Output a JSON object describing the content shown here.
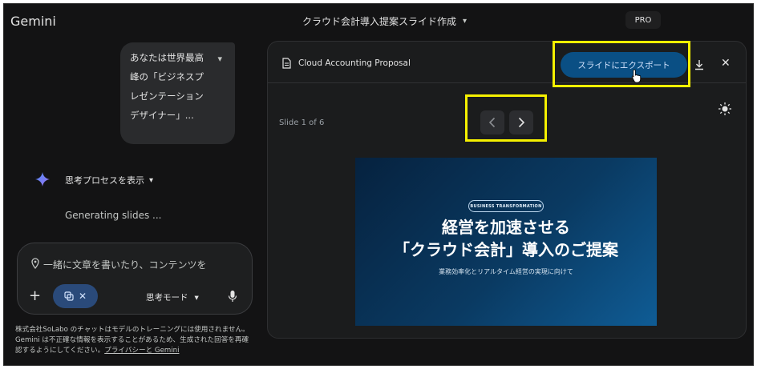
{
  "header": {
    "app_title": "Gemini",
    "chat_title": "クラウド会計導入提案スライド作成",
    "pro_badge": "PRO"
  },
  "chat": {
    "user_message": "あなたは世界最高峰の「ビジネスプレゼンテーションデザイナー」...",
    "thinking_label": "思考プロセスを表示",
    "status": "Generating slides ..."
  },
  "input": {
    "placeholder": "一緒に文章を書いたり、コンテンツを",
    "mode_label": "思考モード"
  },
  "disclaimer": {
    "text": "株式会社SoLabo のチャットはモデルのトレーニングには使用されません。Gemini は不正確な情報を表示することがあるため、生成された回答を再確認するようにしてください。",
    "link": "プライバシーと Gemini"
  },
  "canvas": {
    "doc_title": "Cloud Accounting Proposal",
    "export_label": "スライドにエクスポート",
    "slide_counter": "Slide 1 of 6",
    "slide": {
      "tag": "BUSINESS TRANSFORMATION",
      "title_line1": "経営を加速させる",
      "title_line2": "「クラウド会計」導入のご提案",
      "subtitle": "業務効率化とリアルタイム経営の実現に向けて"
    }
  },
  "colors": {
    "background": "#131314",
    "export_button": "#0a4f84",
    "highlight": "#f5f000",
    "slide_gradient_start": "#06223f",
    "slide_gradient_end": "#0f5c95"
  },
  "icons": [
    "chevron-down-icon",
    "gemini-sparkle-icon",
    "pin-icon",
    "plus-icon",
    "canvas-icon",
    "close-icon",
    "mic-icon",
    "document-icon",
    "download-icon",
    "chevron-left-icon",
    "chevron-right-icon",
    "theme-icon",
    "cursor-icon"
  ]
}
